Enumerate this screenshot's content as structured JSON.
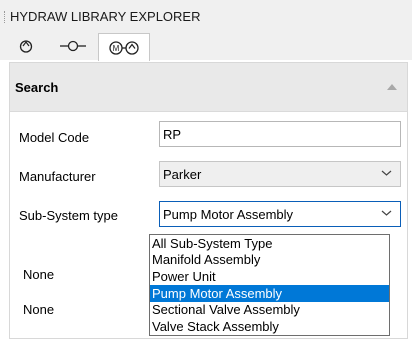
{
  "window": {
    "title": "HYDRAW LIBRARY EXPLORER"
  },
  "toolbar": {
    "buttons": [
      {
        "icon": "pump-icon"
      },
      {
        "icon": "valve-connector-icon"
      },
      {
        "icon": "motor-pump-icon",
        "active": true
      }
    ]
  },
  "search": {
    "header_label": "Search",
    "model_code": {
      "label": "Model Code",
      "value": "RP"
    },
    "manufacturer": {
      "label": "Manufacturer",
      "value": "Parker"
    },
    "subsystem": {
      "label": "Sub-System type",
      "value": "Pump Motor Assembly",
      "options": [
        "All Sub-System Type",
        "Manifold Assembly",
        "Power Unit",
        "Pump Motor Assembly",
        "Sectional Valve Assembly",
        "Valve Stack Assembly"
      ],
      "selected_index": 3
    },
    "row_labels": [
      "None",
      "None"
    ]
  },
  "colors": {
    "selection": "#0078d7",
    "focus_border": "#0a5eb8"
  }
}
